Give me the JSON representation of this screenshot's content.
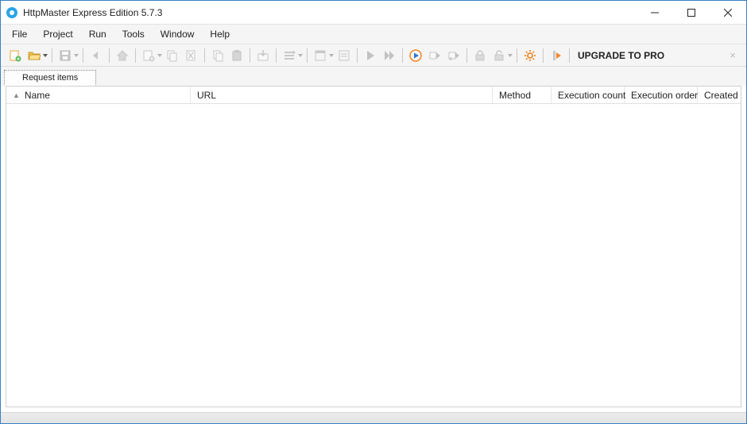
{
  "title": "HttpMaster Express Edition 5.7.3",
  "menu": [
    "File",
    "Project",
    "Run",
    "Tools",
    "Window",
    "Help"
  ],
  "toolbar": {
    "upgrade_label": "UPGRADE TO PRO",
    "buttons": [
      {
        "name": "new-project-icon",
        "enabled": true,
        "has_dropdown": false
      },
      {
        "name": "open-project-icon",
        "enabled": true,
        "has_dropdown": true
      },
      {
        "name": "sep"
      },
      {
        "name": "save-icon",
        "enabled": false,
        "has_dropdown": true
      },
      {
        "name": "sep"
      },
      {
        "name": "back-icon",
        "enabled": false,
        "has_dropdown": false
      },
      {
        "name": "sep"
      },
      {
        "name": "home-icon",
        "enabled": false,
        "has_dropdown": false
      },
      {
        "name": "sep"
      },
      {
        "name": "add-request-icon",
        "enabled": false,
        "has_dropdown": true
      },
      {
        "name": "duplicate-request-icon",
        "enabled": false,
        "has_dropdown": false
      },
      {
        "name": "delete-request-icon",
        "enabled": false,
        "has_dropdown": false
      },
      {
        "name": "sep"
      },
      {
        "name": "copy-icon",
        "enabled": false,
        "has_dropdown": false
      },
      {
        "name": "paste-icon",
        "enabled": false,
        "has_dropdown": false
      },
      {
        "name": "sep"
      },
      {
        "name": "import-icon",
        "enabled": false,
        "has_dropdown": false
      },
      {
        "name": "sep"
      },
      {
        "name": "move-up-icon",
        "enabled": false,
        "has_dropdown": true
      },
      {
        "name": "sep"
      },
      {
        "name": "toggle-panel-icon",
        "enabled": false,
        "has_dropdown": true
      },
      {
        "name": "collapse-icon",
        "enabled": false,
        "has_dropdown": false
      },
      {
        "name": "sep"
      },
      {
        "name": "run-icon",
        "enabled": false,
        "has_dropdown": false
      },
      {
        "name": "run-all-icon",
        "enabled": false,
        "has_dropdown": false
      },
      {
        "name": "sep"
      },
      {
        "name": "run-selected-icon",
        "enabled": true,
        "has_dropdown": false
      },
      {
        "name": "run-basic-icon",
        "enabled": false,
        "has_dropdown": false
      },
      {
        "name": "run-advanced-icon",
        "enabled": false,
        "has_dropdown": false
      },
      {
        "name": "sep"
      },
      {
        "name": "lock-icon",
        "enabled": false,
        "has_dropdown": false
      },
      {
        "name": "unlock-icon",
        "enabled": false,
        "has_dropdown": true
      },
      {
        "name": "sep"
      },
      {
        "name": "settings-icon",
        "enabled": true,
        "has_dropdown": false
      },
      {
        "name": "sep"
      },
      {
        "name": "upgrade-icon",
        "enabled": true,
        "has_dropdown": false
      }
    ]
  },
  "tabs": [
    {
      "label": "Request items",
      "active": true
    }
  ],
  "table": {
    "columns": [
      {
        "key": "name",
        "label": "Name",
        "sort": "asc"
      },
      {
        "key": "url",
        "label": "URL"
      },
      {
        "key": "method",
        "label": "Method"
      },
      {
        "key": "exec_count",
        "label": "Execution count"
      },
      {
        "key": "exec_order",
        "label": "Execution order"
      },
      {
        "key": "created",
        "label": "Created"
      }
    ],
    "rows": []
  }
}
